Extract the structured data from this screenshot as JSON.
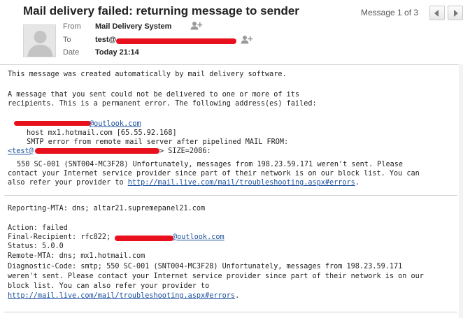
{
  "header": {
    "subject": "Mail delivery failed: returning message to sender",
    "message_counter": "Message 1 of 3",
    "from_label": "From",
    "from_value": "Mail Delivery System",
    "to_label": "To",
    "to_value": "test@",
    "date_label": "Date",
    "date_value": "Today 21:14"
  },
  "body": {
    "intro": "This message was created automatically by mail delivery software.",
    "para1_line1": "A message that you sent could not be delivered to one or more of its",
    "para1_line2": "recipients. This is a permanent error. The following address(es) failed:",
    "failed_address_domain": "@outlook.com",
    "host_line": "host mx1.hotmail.com [65.55.92.168]",
    "smtp_line": "SMTP error from remote mail server after pipelined MAIL FROM:",
    "mail_from_prefix": "<test@",
    "mail_from_suffix": "> SIZE=2086:",
    "error_line1": "550 SC-001 (SNT004-MC3F28) Unfortunately, messages from 198.23.59.171 weren't sent. Please",
    "error_line2": "contact your Internet service provider since part of their network is on our block list. You can",
    "error_line3_prefix": "also refer your provider to ",
    "error_link": "http://mail.live.com/mail/troubleshooting.aspx#errors",
    "error_line3_suffix": ".",
    "reporting_mta": "Reporting-MTA: dns; altar21.supremepanel21.com",
    "action": "Action: failed",
    "final_recipient_prefix": "Final-Recipient: rfc822;",
    "final_recipient_domain": "@outlook.com",
    "status": "Status: 5.0.0",
    "remote_mta": "Remote-MTA: dns; mx1.hotmail.com",
    "diag_line1": "Diagnostic-Code: smtp; 550 SC-001 (SNT004-MC3F28) Unfortunately, messages from 198.23.59.171",
    "diag_line2": "weren't sent. Please contact your Internet service provider since part of their network is on our",
    "diag_line3": "block list. You can also refer your provider to",
    "diag_link": "http://mail.live.com/mail/troubleshooting.aspx#errors",
    "diag_link_suffix": "."
  },
  "colors": {
    "redaction": "#e8101c",
    "link": "#1a4f9c"
  },
  "icons": {
    "prev": "chevron-left-icon",
    "next": "chevron-right-icon",
    "add_contact": "add-contact-icon",
    "avatar": "avatar-placeholder-icon"
  }
}
